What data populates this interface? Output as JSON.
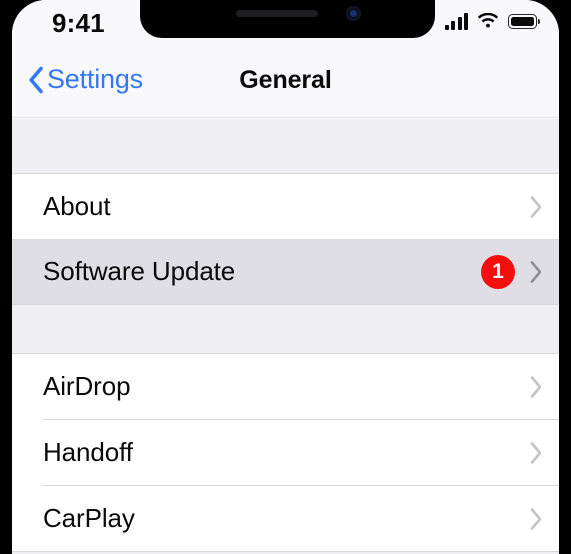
{
  "status_bar": {
    "time": "9:41",
    "cellular_icon": "cellular-signal-icon",
    "wifi_icon": "wifi-icon",
    "battery_icon": "battery-full-icon"
  },
  "nav_bar": {
    "back_label": "Settings",
    "back_icon": "chevron-left-icon",
    "title": "General"
  },
  "colors": {
    "accent_blue": "#3478F6",
    "badge_red": "#F40E0E",
    "group_background": "#EFEFF4",
    "row_background": "#FFFFFF",
    "row_selected": "#DEDEE4",
    "separator": "#D8D8DC"
  },
  "sections": [
    {
      "rows": [
        {
          "label": "About",
          "badge": null,
          "chevron": "chevron-right-icon",
          "selected": false
        },
        {
          "label": "Software Update",
          "badge": "1",
          "chevron": "chevron-right-icon",
          "selected": true
        }
      ]
    },
    {
      "rows": [
        {
          "label": "AirDrop",
          "badge": null,
          "chevron": "chevron-right-icon",
          "selected": false
        },
        {
          "label": "Handoff",
          "badge": null,
          "chevron": "chevron-right-icon",
          "selected": false
        },
        {
          "label": "CarPlay",
          "badge": null,
          "chevron": "chevron-right-icon",
          "selected": false
        }
      ]
    }
  ]
}
